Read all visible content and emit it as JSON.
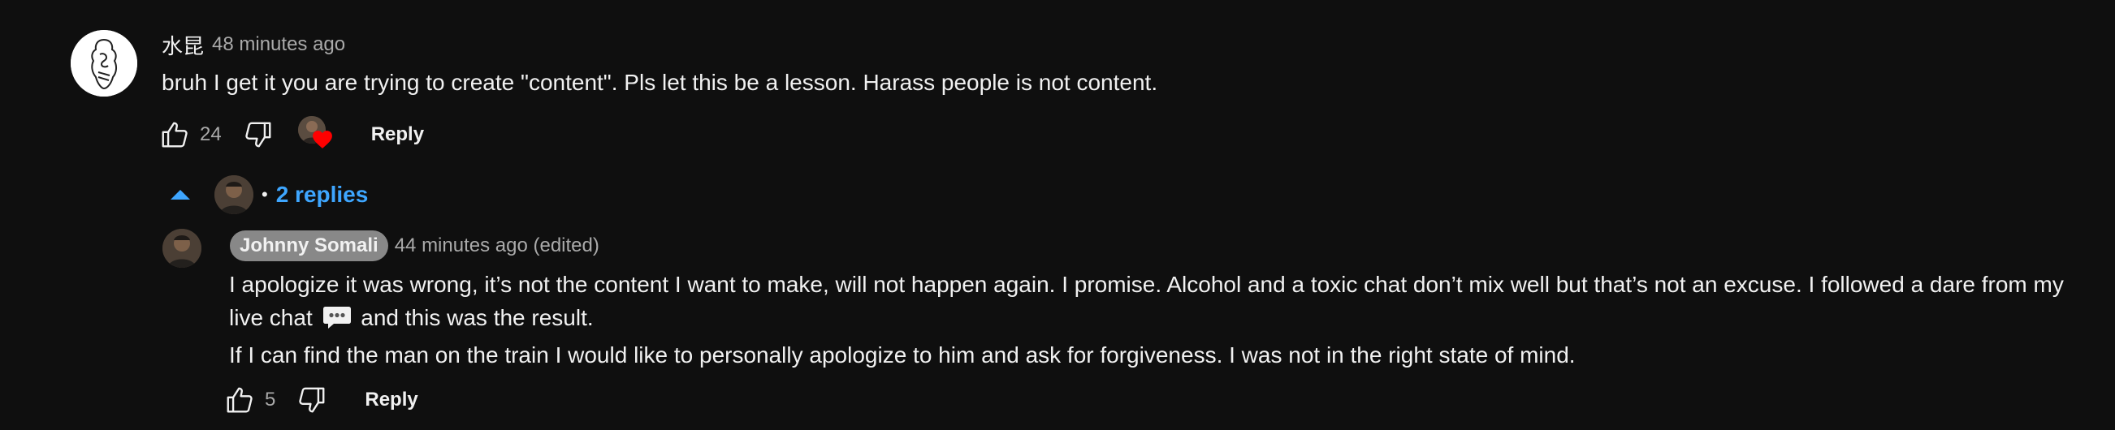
{
  "comment": {
    "author": "水昆",
    "timestamp": "48 minutes ago",
    "text": "bruh I get it you are trying to create \"content\". Pls let this be a lesson. Harass people is not content.",
    "likes": "24",
    "reply_label": "Reply"
  },
  "replies_toggle": {
    "dot": "•",
    "label": "2 replies"
  },
  "reply": {
    "author": "Johnny Somali",
    "timestamp": "44 minutes ago (edited)",
    "line1": "I apologize it was wrong, it’s not the content I want to make, will not happen again. I promise. Alcohol and a toxic chat don’t mix well but that’s not an excuse. I followed a dare from my",
    "line2_a": "live chat",
    "line2_b": "and this was the result.",
    "line3": "If I can find the man on the train I would like to personally apologize to him and ask for forgiveness. I was not in the right state of mind.",
    "likes": "5",
    "reply_label": "Reply"
  },
  "icons": {
    "like": "thumbs-up-icon",
    "dislike": "thumbs-down-icon",
    "heart": "heart-icon",
    "caret": "caret-up-icon",
    "chat": "speech-bubble-emoji"
  },
  "colors": {
    "background": "#0f0f0f",
    "text": "#f1f1f1",
    "secondary": "#aaaaaa",
    "link_blue": "#3ea6ff",
    "heart_red": "#ff0000",
    "author_chip": "#888888"
  }
}
